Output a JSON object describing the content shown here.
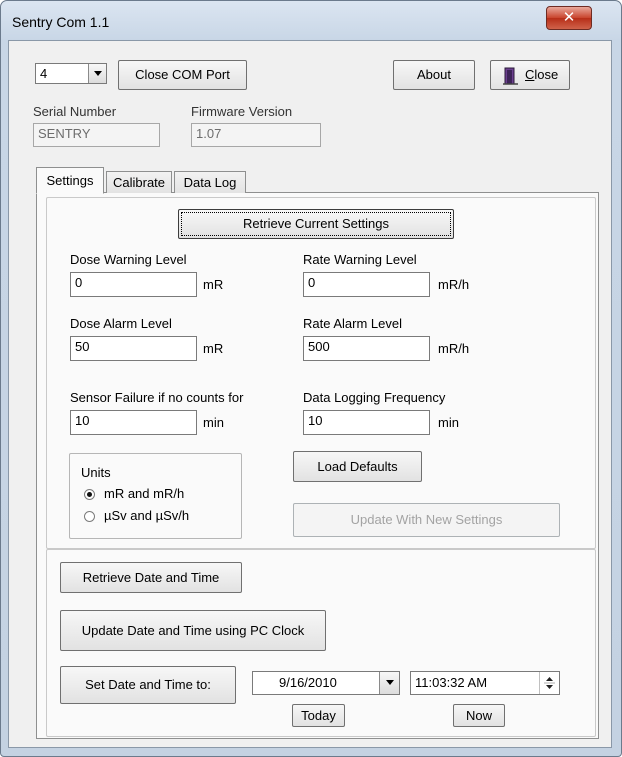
{
  "window": {
    "title": "Sentry Com 1.1",
    "close_glyph": "✕"
  },
  "com": {
    "port_value": "4",
    "close_port_label": "Close COM Port"
  },
  "top_buttons": {
    "about_label": "About",
    "close_label": "Close",
    "close_accel": "C",
    "close_rest": "lose",
    "close_icon": "door-exit-icon"
  },
  "device": {
    "serial_label": "Serial Number",
    "serial_value": "SENTRY",
    "firmware_label": "Firmware Version",
    "firmware_value": "1.07"
  },
  "tabs": [
    {
      "label": "Settings",
      "active": true
    },
    {
      "label": "Calibrate",
      "active": false
    },
    {
      "label": "Data Log",
      "active": false
    }
  ],
  "settings": {
    "retrieve_label": "Retrieve Current Settings",
    "dose_warning": {
      "label": "Dose Warning Level",
      "value": "0",
      "unit": "mR"
    },
    "rate_warning": {
      "label": "Rate Warning Level",
      "value": "0",
      "unit": "mR/h"
    },
    "dose_alarm": {
      "label": "Dose Alarm Level",
      "value": "50",
      "unit": "mR"
    },
    "rate_alarm": {
      "label": "Rate Alarm Level",
      "value": "500",
      "unit": "mR/h"
    },
    "sensor_failure": {
      "label": "Sensor Failure if no counts for",
      "value": "10",
      "unit": "min"
    },
    "logging_freq": {
      "label": "Data Logging Frequency",
      "value": "10",
      "unit": "min"
    },
    "units": {
      "title": "Units",
      "options": [
        {
          "label": "mR and mR/h",
          "selected": true
        },
        {
          "label": "µSv and µSv/h",
          "selected": false
        }
      ]
    },
    "load_defaults_label": "Load Defaults",
    "update_label": "Update With New Settings"
  },
  "datetime": {
    "retrieve_label": "Retrieve Date and Time",
    "update_pc_label": "Update Date and Time using PC Clock",
    "set_label": "Set Date and Time to:",
    "date_value": "9/16/2010",
    "time_value": "11:03:32 AM",
    "today_label": "Today",
    "now_label": "Now"
  }
}
